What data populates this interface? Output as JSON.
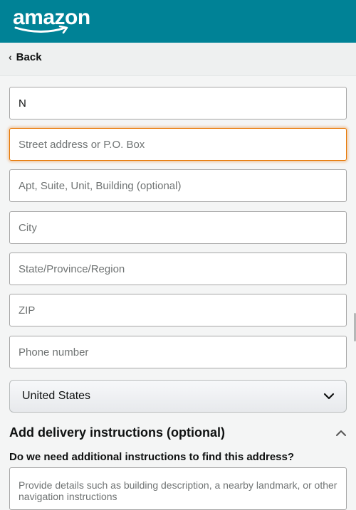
{
  "header": {
    "logo_text": "amazon",
    "logo_name": "amazon-logo",
    "brand_color": "#008296"
  },
  "nav": {
    "back_label": "Back",
    "back_icon": "chevron-left-icon"
  },
  "form": {
    "full_name": {
      "value": "N",
      "placeholder": ""
    },
    "street": {
      "value": "",
      "placeholder": "Street address or P.O. Box"
    },
    "apt": {
      "value": "",
      "placeholder": "Apt, Suite, Unit, Building (optional)"
    },
    "city": {
      "value": "",
      "placeholder": "City"
    },
    "state": {
      "value": "",
      "placeholder": "State/Province/Region"
    },
    "zip": {
      "value": "",
      "placeholder": "ZIP"
    },
    "phone": {
      "value": "",
      "placeholder": "Phone number"
    },
    "country": {
      "selected": "United States",
      "icon": "chevron-down-icon"
    }
  },
  "delivery_instructions": {
    "title": "Add delivery instructions (optional)",
    "toggle_icon": "chevron-up-icon",
    "question": "Do we need additional instructions to find this address?",
    "textarea_placeholder": "Provide details such as building description, a nearby landmark, or other navigation instructions"
  },
  "colors": {
    "focus_border": "#e77600",
    "page_bg": "#f4f5f5"
  }
}
